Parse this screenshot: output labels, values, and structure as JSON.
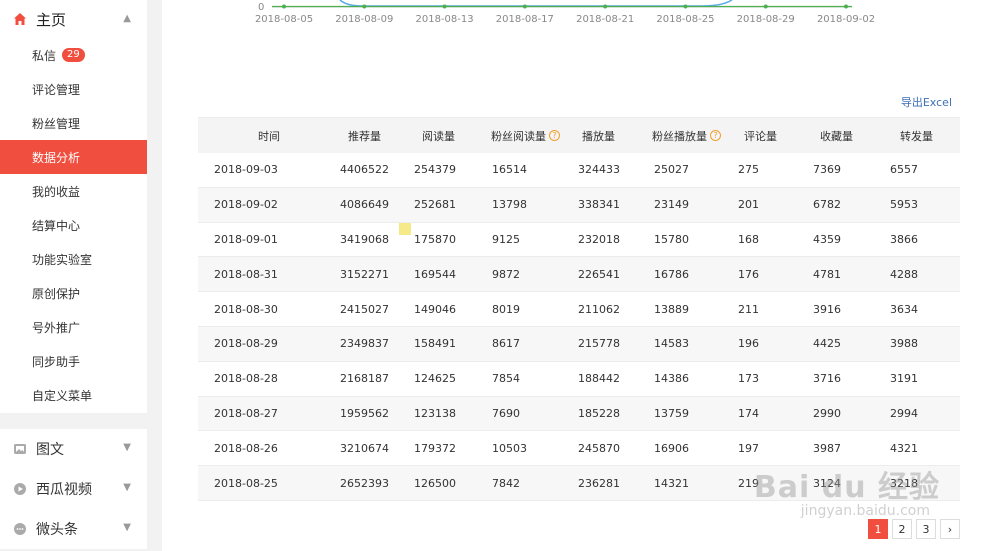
{
  "sidebar": {
    "home": "主页",
    "items": [
      {
        "label": "私信",
        "badge": "29"
      },
      {
        "label": "评论管理"
      },
      {
        "label": "粉丝管理"
      },
      {
        "label": "数据分析",
        "active": true
      },
      {
        "label": "我的收益"
      },
      {
        "label": "结算中心"
      },
      {
        "label": "功能实验室"
      },
      {
        "label": "原创保护"
      },
      {
        "label": "号外推广"
      },
      {
        "label": "同步助手"
      },
      {
        "label": "自定义菜单"
      }
    ],
    "sections": [
      {
        "label": "图文",
        "icon": "image-icon"
      },
      {
        "label": "西瓜视频",
        "icon": "play-icon"
      },
      {
        "label": "微头条",
        "icon": "chat-icon"
      }
    ]
  },
  "chart_data": {
    "type": "line",
    "x_ticks": [
      "2018-08-05",
      "2018-08-09",
      "2018-08-13",
      "2018-08-17",
      "2018-08-21",
      "2018-08-25",
      "2018-08-29",
      "2018-09-02"
    ],
    "y_tick": "0"
  },
  "export_label": "导出Excel",
  "table": {
    "headers": [
      "时间",
      "推荐量",
      "阅读量",
      "粉丝阅读量",
      "播放量",
      "粉丝播放量",
      "评论量",
      "收藏量",
      "转发量"
    ],
    "rows": [
      [
        "2018-09-03",
        "4406522",
        "254379",
        "16514",
        "324433",
        "25027",
        "275",
        "7369",
        "6557"
      ],
      [
        "2018-09-02",
        "4086649",
        "252681",
        "13798",
        "338341",
        "23149",
        "201",
        "6782",
        "5953"
      ],
      [
        "2018-09-01",
        "3419068",
        "175870",
        "9125",
        "232018",
        "15780",
        "168",
        "4359",
        "3866"
      ],
      [
        "2018-08-31",
        "3152271",
        "169544",
        "9872",
        "226541",
        "16786",
        "176",
        "4781",
        "4288"
      ],
      [
        "2018-08-30",
        "2415027",
        "149046",
        "8019",
        "211062",
        "13889",
        "211",
        "3916",
        "3634"
      ],
      [
        "2018-08-29",
        "2349837",
        "158491",
        "8617",
        "215778",
        "14583",
        "196",
        "4425",
        "3988"
      ],
      [
        "2018-08-28",
        "2168187",
        "124625",
        "7854",
        "188442",
        "14386",
        "173",
        "3716",
        "3191"
      ],
      [
        "2018-08-27",
        "1959562",
        "123138",
        "7690",
        "185228",
        "13759",
        "174",
        "2990",
        "2994"
      ],
      [
        "2018-08-26",
        "3210674",
        "179372",
        "10503",
        "245870",
        "16906",
        "197",
        "3987",
        "4321"
      ],
      [
        "2018-08-25",
        "2652393",
        "126500",
        "7842",
        "236281",
        "14321",
        "219",
        "3124",
        "3218"
      ]
    ]
  },
  "pagination": {
    "pages": [
      "1",
      "2",
      "3"
    ],
    "current": "1",
    "next": "›"
  },
  "watermark": {
    "brand": "Bai du 经验",
    "url": "jingyan.baidu.com"
  }
}
